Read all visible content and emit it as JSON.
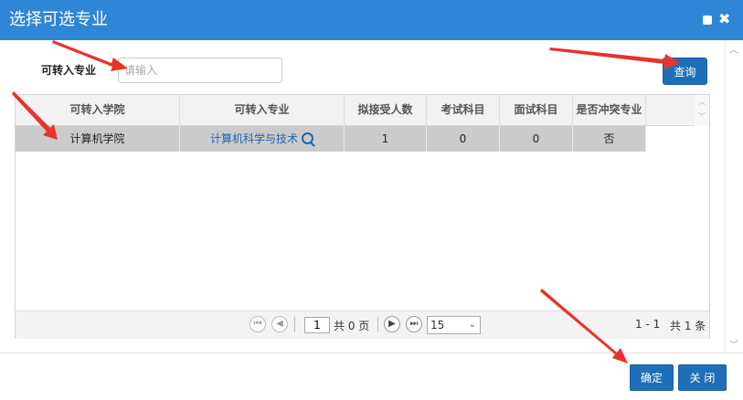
{
  "dialog": {
    "title": "选择可选专业"
  },
  "search": {
    "label": "可转入专业",
    "placeholder": "请输入",
    "value": "",
    "query_button": "查询"
  },
  "grid": {
    "columns": [
      "可转入学院",
      "可转入专业",
      "拟接受人数",
      "考试科目",
      "面试科目",
      "是否冲突专业"
    ],
    "rows": [
      {
        "college": "计算机学院",
        "major": "计算机科学与技术",
        "quota": "1",
        "exam_subjects": "0",
        "interview_subjects": "0",
        "conflict": "否"
      }
    ]
  },
  "pager": {
    "current_page": "1",
    "total_pages_text": "共 0 页",
    "page_size": "15",
    "range_text": "1 - 1",
    "total_text": "共 1 条"
  },
  "footer": {
    "confirm": "确定",
    "close": "关 闭"
  },
  "colors": {
    "title_bar": "#2f86d6",
    "primary_button": "#1e6fb8",
    "selected_row": "#cbcbcb",
    "link": "#1d64b4",
    "annotation_arrow": "#e8322c"
  },
  "icons": {
    "maximize": "maximize-icon",
    "close": "close-icon",
    "search": "magnifier-icon",
    "pager": [
      "first-page-icon",
      "prev-page-icon",
      "next-page-icon",
      "last-page-icon"
    ]
  }
}
